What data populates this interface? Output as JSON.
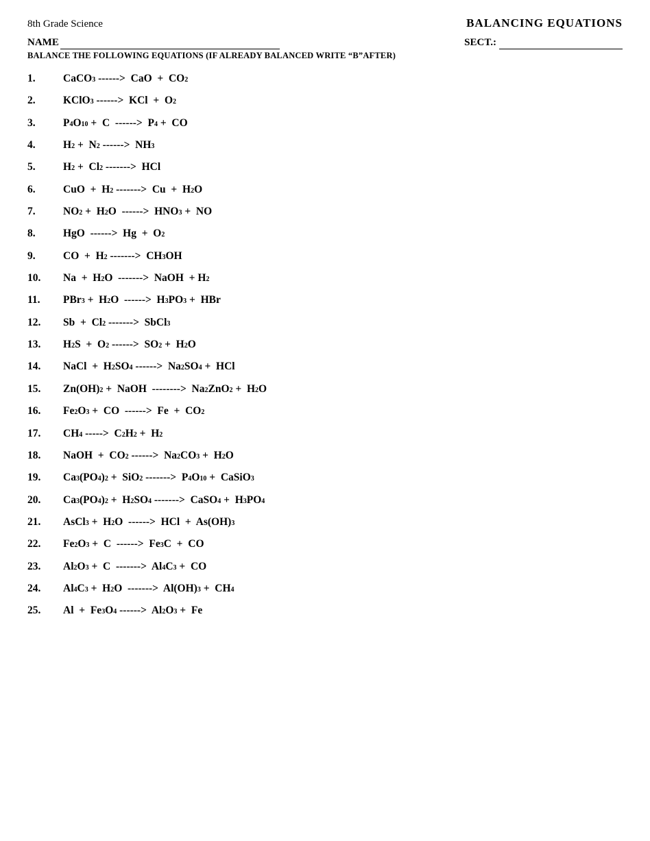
{
  "header": {
    "left": "8th Grade Science",
    "center": "BALANCING EQUATIONS"
  },
  "name_label": "NAME",
  "sect_label": "SECT.:",
  "instructions": "BALANCE THE FOLLOWING EQUATIONS (IF ALREADY BALANCED WRITE “B”AFTER)",
  "equations": [
    {
      "num": "1.",
      "html": "CaCO<sub>3</sub> &nbsp;------&gt;&nbsp; CaO &nbsp;+&nbsp; CO<sub>2</sub>"
    },
    {
      "num": "2.",
      "html": "KClO<sub>3</sub> &nbsp;------&gt;&nbsp; KCl &nbsp;+&nbsp; O<sub>2</sub>"
    },
    {
      "num": "3.",
      "html": "P<sub>4</sub>O<sub>10</sub> &nbsp;+&nbsp; C &nbsp;------&gt;&nbsp; P<sub>4</sub> &nbsp;+&nbsp; CO"
    },
    {
      "num": "4.",
      "html": "H<sub>2</sub> &nbsp;+&nbsp; N<sub>2</sub> &nbsp;------&gt;&nbsp; NH<sub>3</sub>"
    },
    {
      "num": "5.",
      "html": "H<sub>2</sub> &nbsp;+&nbsp; Cl<sub>2</sub> &nbsp;-------&gt;&nbsp; HCl"
    },
    {
      "num": "6.",
      "html": "CuO &nbsp;+&nbsp; H<sub>2</sub> &nbsp;-------&gt;&nbsp; Cu &nbsp;+&nbsp; H<sub>2</sub>O"
    },
    {
      "num": "7.",
      "html": "NO<sub>2</sub> &nbsp;+&nbsp; H<sub>2</sub>O &nbsp;------&gt;&nbsp; HNO<sub>3</sub> &nbsp;+&nbsp; NO"
    },
    {
      "num": "8.",
      "html": "HgO &nbsp;------&gt;&nbsp; Hg &nbsp;+&nbsp; O<sub>2</sub>"
    },
    {
      "num": "9.",
      "html": "CO &nbsp;+&nbsp; H<sub>2</sub> &nbsp;-------&gt;&nbsp; CH<sub>3</sub>OH"
    },
    {
      "num": "10.",
      "html": "Na &nbsp;+&nbsp; H<sub>2</sub>O &nbsp;-------&gt;&nbsp; NaOH &nbsp;+&nbsp;H<sub>2</sub>"
    },
    {
      "num": "11.",
      "html": "PBr<sub>3</sub> &nbsp;+&nbsp; H<sub>2</sub>O &nbsp;------&gt;&nbsp; H<sub>3</sub>PO<sub>3</sub> &nbsp;+&nbsp; HBr"
    },
    {
      "num": "12.",
      "html": "Sb &nbsp;+&nbsp; Cl<sub>2</sub> &nbsp;-------&gt;&nbsp; SbCl<sub>3</sub>"
    },
    {
      "num": "13.",
      "html": "H<sub>2</sub>S &nbsp;+&nbsp; O<sub>2</sub> &nbsp;------&gt;&nbsp; SO<sub>2</sub> &nbsp;+&nbsp; H<sub>2</sub>O"
    },
    {
      "num": "14.",
      "html": "NaCl &nbsp;+&nbsp; H<sub>2</sub>SO<sub>4</sub> &nbsp;------&gt;&nbsp; Na<sub>2</sub>SO<sub>4</sub> &nbsp;+&nbsp; HCl"
    },
    {
      "num": "15.",
      "html": "Zn(OH)<sub>2</sub> &nbsp;+&nbsp; NaOH &nbsp;--------&gt;&nbsp; Na<sub>2</sub>ZnO<sub>2</sub> &nbsp;+&nbsp; H<sub>2</sub>O"
    },
    {
      "num": "16.",
      "html": "Fe<sub>2</sub>O<sub>3</sub> &nbsp;+&nbsp; CO &nbsp;------&gt;&nbsp; Fe &nbsp;+&nbsp; CO<sub>2</sub>"
    },
    {
      "num": "17.",
      "html": "CH<sub>4</sub> &nbsp;-----&gt;&nbsp; C<sub>2</sub>H<sub>2</sub> &nbsp;+&nbsp; H<sub>2</sub>"
    },
    {
      "num": "18.",
      "html": "NaOH &nbsp;+&nbsp; CO<sub>2</sub> &nbsp;------&gt;&nbsp; Na<sub>2</sub>CO<sub>3</sub> &nbsp;+&nbsp; H<sub>2</sub>O"
    },
    {
      "num": "19.",
      "html": "Ca<sub>3</sub>(PO<sub>4</sub>)<sub>2</sub> &nbsp;+&nbsp; SiO<sub>2</sub> &nbsp;-------&gt;&nbsp; P<sub>4</sub>O<sub>10</sub> &nbsp;+&nbsp; CaSiO<sub>3</sub>"
    },
    {
      "num": "20.",
      "html": "Ca<sub>3</sub>(PO<sub>4</sub>)<sub>2</sub> &nbsp;+&nbsp; H<sub>2</sub>SO<sub>4</sub> &nbsp;-------&gt;&nbsp; CaSO<sub>4</sub> &nbsp;+&nbsp; H<sub>3</sub>PO<sub>4</sub>"
    },
    {
      "num": "21.",
      "html": "AsCl<sub>3</sub> &nbsp;+&nbsp; H<sub>2</sub>O &nbsp;------&gt;&nbsp; HCl &nbsp;+&nbsp; As(OH)<sub>3</sub>"
    },
    {
      "num": "22.",
      "html": "Fe<sub>2</sub>O<sub>3</sub> &nbsp;+&nbsp; C &nbsp;------&gt;&nbsp; Fe<sub>3</sub>C &nbsp;+&nbsp; CO"
    },
    {
      "num": "23.",
      "html": "Al<sub>2</sub>O<sub>3</sub> &nbsp;+&nbsp; C &nbsp;-------&gt;&nbsp; Al<sub>4</sub>C<sub>3</sub> &nbsp;+&nbsp; CO"
    },
    {
      "num": "24.",
      "html": "Al<sub>4</sub>C<sub>3</sub> &nbsp;+&nbsp; H<sub>2</sub>O &nbsp;-------&gt;&nbsp; Al(OH)<sub>3</sub> &nbsp;+&nbsp; CH<sub>4</sub>"
    },
    {
      "num": "25.",
      "html": "Al &nbsp;+&nbsp; Fe<sub>3</sub>O<sub>4</sub> &nbsp;------&gt;&nbsp; Al<sub>2</sub>O<sub>3</sub> &nbsp;+&nbsp; Fe"
    }
  ]
}
